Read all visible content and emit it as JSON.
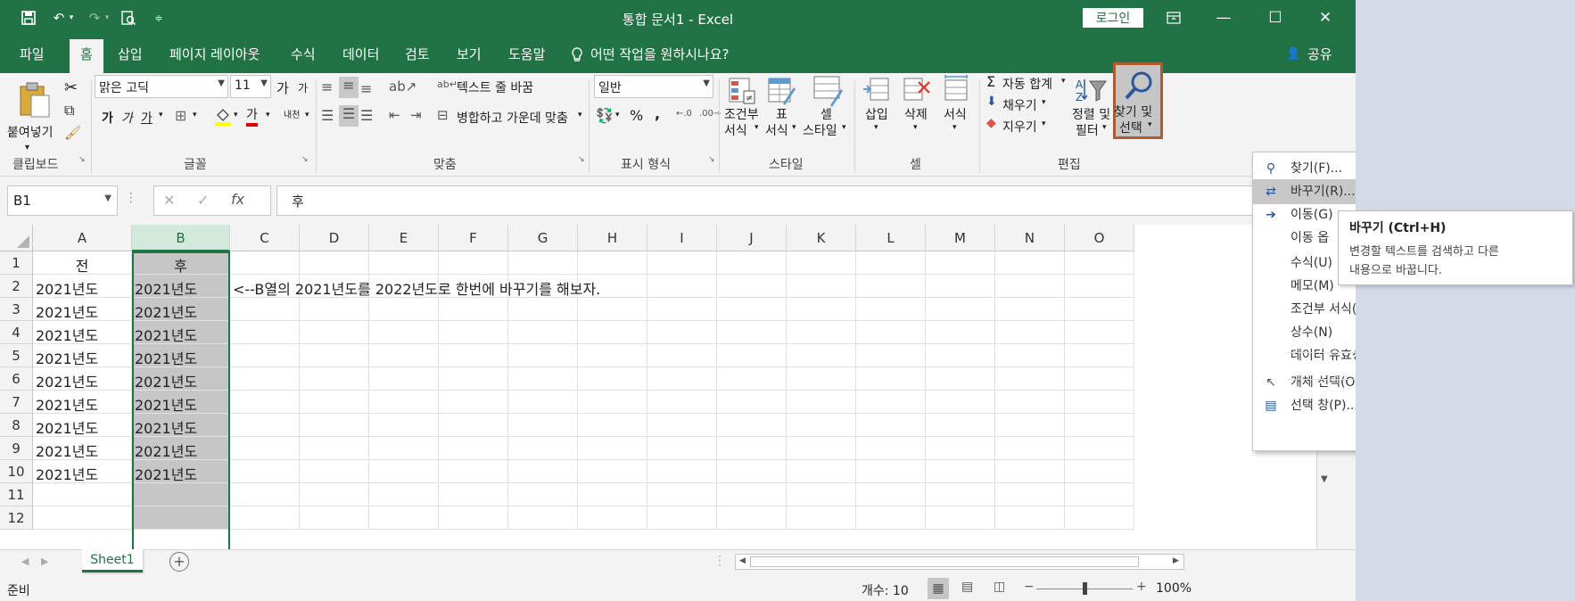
{
  "app": {
    "title": "통합 문서1  -  Excel",
    "login_label": "로그인",
    "ribbon_display_icon": "ribbon-display-icon",
    "minimize_icon": "minimize-icon",
    "maximize_icon": "maximize-icon",
    "close_icon": "close-icon"
  },
  "quick_access": [
    "save-icon",
    "undo-icon",
    "redo-icon",
    "print-preview-icon",
    "customize-icon"
  ],
  "menu": {
    "tabs": [
      "파일",
      "홈",
      "삽입",
      "페이지 레이아웃",
      "수식",
      "데이터",
      "검토",
      "보기",
      "도움말"
    ],
    "active_tab": "홈",
    "tell_me": "어떤 작업을 원하시나요?",
    "share": "공유"
  },
  "ribbon": {
    "clipboard": {
      "label": "클립보드",
      "paste": "붙여넣기"
    },
    "font": {
      "label": "글꼴",
      "name": "맑은 고딕",
      "size": "11",
      "grow": "가",
      "shrink": "가",
      "bold": "가",
      "italic": "가",
      "underline": "가",
      "color_letter": "가",
      "phonetic": "내천"
    },
    "alignment": {
      "label": "맞춤",
      "wrap": "텍스트 줄 바꿈",
      "merge": "병합하고 가운데 맞춤"
    },
    "number": {
      "label": "표시 형식",
      "format": "일반",
      "percent": "%",
      "comma": ","
    },
    "styles": {
      "label": "스타일",
      "conditional": [
        "조건부",
        "서식"
      ],
      "table": [
        "표",
        "서식"
      ],
      "cell": [
        "셀",
        "스타일"
      ]
    },
    "cells": {
      "label": "셀",
      "insert": "삽입",
      "delete": "삭제",
      "format": "서식"
    },
    "editing": {
      "label": "편집",
      "autosum": "자동 합계",
      "fill": "채우기",
      "clear": "지우기",
      "sort": [
        "정렬 및",
        "필터"
      ],
      "find": [
        "찾기 및",
        "선택"
      ]
    }
  },
  "formula_bar": {
    "name_box": "B1",
    "fx": "fx",
    "value": "후"
  },
  "sheet": {
    "columns": [
      "A",
      "B",
      "C",
      "D",
      "E",
      "F",
      "G",
      "H",
      "I",
      "J",
      "K",
      "L",
      "M",
      "N",
      "O"
    ],
    "selected_column": "B",
    "rows": [
      "1",
      "2",
      "3",
      "4",
      "5",
      "6",
      "7",
      "8",
      "9",
      "10",
      "11",
      "12"
    ],
    "col_a": [
      "전",
      "2021년도",
      "2021년도",
      "2021년도",
      "2021년도",
      "2021년도",
      "2021년도",
      "2021년도",
      "2021년도",
      "2021년도",
      "",
      ""
    ],
    "col_b": [
      "후",
      "2021년도",
      "2021년도",
      "2021년도",
      "2021년도",
      "2021년도",
      "2021년도",
      "2021년도",
      "2021년도",
      "2021년도",
      "",
      ""
    ],
    "c2_note": "<--B열의 2021년도를 2022년도로 한번에 바꾸기를 해보자."
  },
  "sheet_tabs": {
    "active": "Sheet1",
    "add_icon": "add-sheet-icon"
  },
  "status": {
    "mode": "준비",
    "count": "개수: 10",
    "zoom": "100%"
  },
  "find_menu": {
    "items": [
      {
        "icon": "find-icon",
        "label": "찾기(F)..."
      },
      {
        "icon": "replace-icon",
        "label": "바꾸기(R)..."
      },
      {
        "icon": "goto-arrow-icon",
        "label": "이동(G)"
      },
      {
        "icon": "",
        "label": "이동 옵"
      },
      {
        "icon": "",
        "label": "수식(U)"
      },
      {
        "icon": "",
        "label": "메모(M)"
      },
      {
        "icon": "",
        "label": "조건부 서식(C)"
      },
      {
        "icon": "",
        "label": "상수(N)"
      },
      {
        "icon": "",
        "label": "데이터 유효성 검사(V)"
      },
      {
        "icon": "cursor-icon",
        "label": "개체 선택(O)"
      },
      {
        "icon": "selection-pane-icon",
        "label": "선택 창(P)..."
      }
    ],
    "highlighted": 1
  },
  "tooltip": {
    "title": "바꾸기 (Ctrl+H)",
    "body_1": "변경할 텍스트를 검색하고 다른",
    "body_2": "내용으로 바꿉니다."
  },
  "colors": {
    "excel_green": "#217346",
    "selected_col_fill": "#c6c6c6",
    "highlight_border": "#b05a32"
  }
}
